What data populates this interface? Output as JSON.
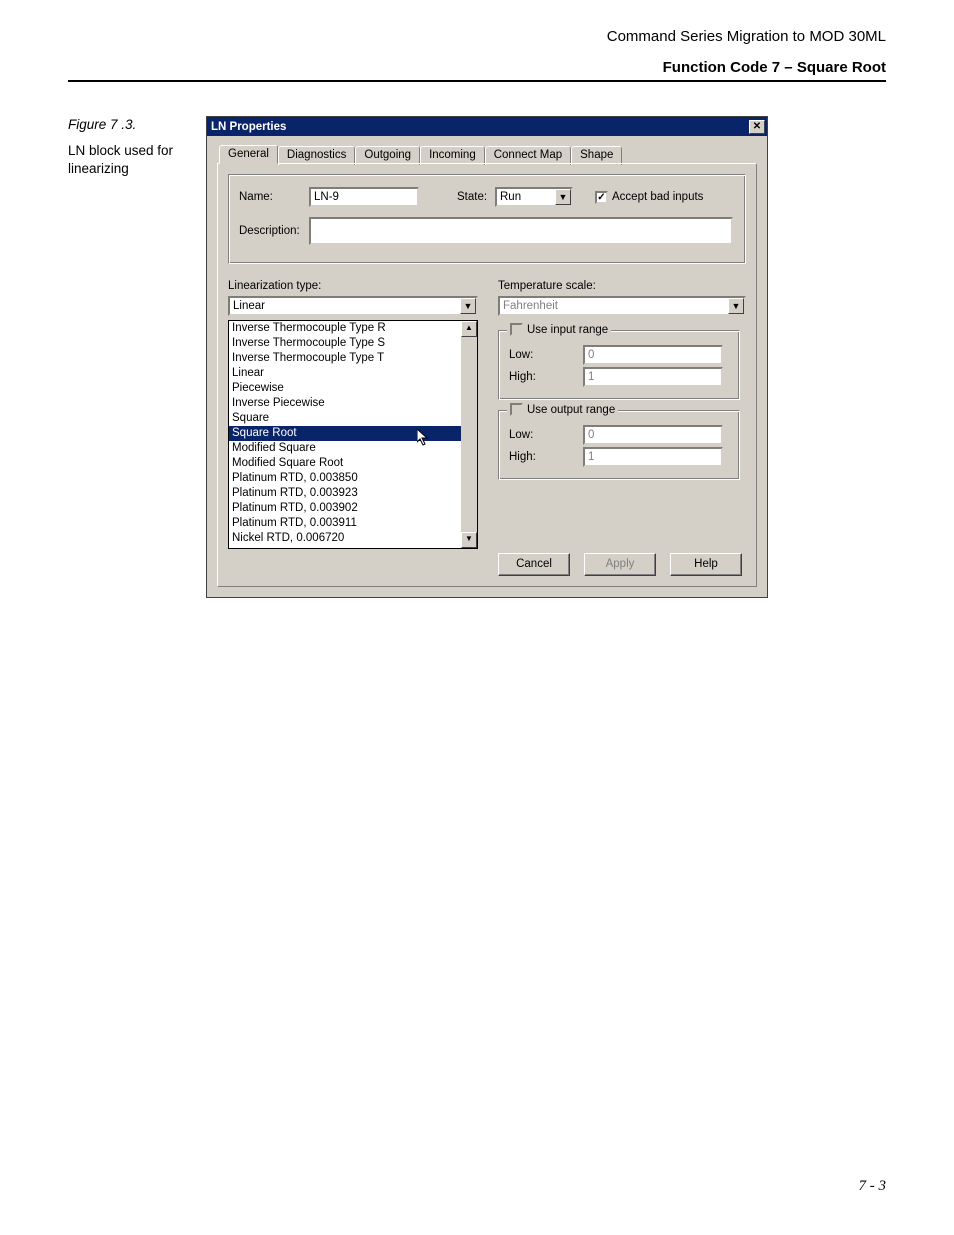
{
  "doc": {
    "header1": "Command Series Migration to MOD 30ML",
    "header2": "Function Code 7 – Square Root",
    "figure_label": "Figure 7 .3.",
    "figure_caption": "LN block used for linearizing",
    "page_number": "7 - 3"
  },
  "dialog": {
    "title": "LN Properties",
    "tabs": [
      "General",
      "Diagnostics",
      "Outgoing",
      "Incoming",
      "Connect Map",
      "Shape"
    ],
    "active_tab": 0,
    "name_label": "Name:",
    "name_value": "LN-9",
    "state_label": "State:",
    "state_value": "Run",
    "accept_label": "Accept bad inputs",
    "accept_checked": true,
    "desc_label": "Description:",
    "desc_value": "",
    "lintype_label": "Linearization type:",
    "lintype_value": "Linear",
    "lintype_options": [
      "Inverse Thermocouple Type R",
      "Inverse Thermocouple Type S",
      "Inverse Thermocouple Type T",
      "Linear",
      "Piecewise",
      "Inverse Piecewise",
      "Square",
      "Square Root",
      "Modified Square",
      "Modified Square Root",
      "Platinum RTD, 0.003850",
      "Platinum RTD, 0.003923",
      "Platinum RTD, 0.003902",
      "Platinum RTD, 0.003911",
      "Nickel RTD, 0.006720"
    ],
    "lintype_selected": "Square Root",
    "tempscale_label": "Temperature scale:",
    "tempscale_value": "Fahrenheit",
    "input_range": {
      "legend": "Use input range",
      "low_label": "Low:",
      "low": "0",
      "high_label": "High:",
      "high": "1"
    },
    "output_range": {
      "legend": "Use output range",
      "low_label": "Low:",
      "low": "0",
      "high_label": "High:",
      "high": "1"
    },
    "buttons": {
      "cancel": "Cancel",
      "apply": "Apply",
      "help": "Help"
    }
  }
}
